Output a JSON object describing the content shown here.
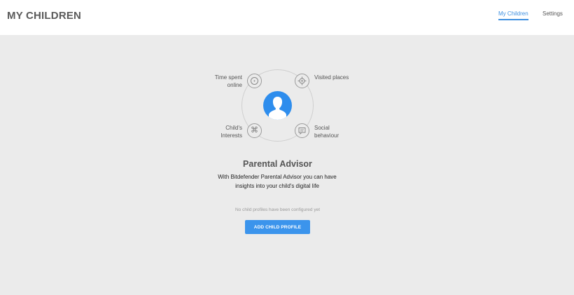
{
  "header": {
    "title": "MY CHILDREN",
    "tabs": [
      {
        "label": "My Children",
        "active": true
      },
      {
        "label": "Settings",
        "active": false
      }
    ]
  },
  "features": {
    "time_spent": {
      "line1": "Time spent",
      "line2": "online",
      "icon": "clock-icon"
    },
    "visited_places": {
      "line1": "Visited places",
      "icon": "location-target-icon"
    },
    "interests": {
      "line1": "Child's",
      "line2": "Interests",
      "icon": "command-icon"
    },
    "social": {
      "line1": "Social",
      "line2": "behaviour",
      "icon": "chat-icon"
    }
  },
  "avatar": {
    "icon": "user-silhouette-icon",
    "color": "#2e8ded"
  },
  "advisor": {
    "title": "Parental Advisor",
    "description_line1": "With Bitdefender Parental Advisor you can have",
    "description_line2": "insights into your child's digital life"
  },
  "empty_state": "No child profiles have been configured yet",
  "add_button": "ADD CHILD PROFILE",
  "colors": {
    "accent": "#3d8fe0",
    "button": "#3b94ec",
    "background": "#ebebeb"
  }
}
